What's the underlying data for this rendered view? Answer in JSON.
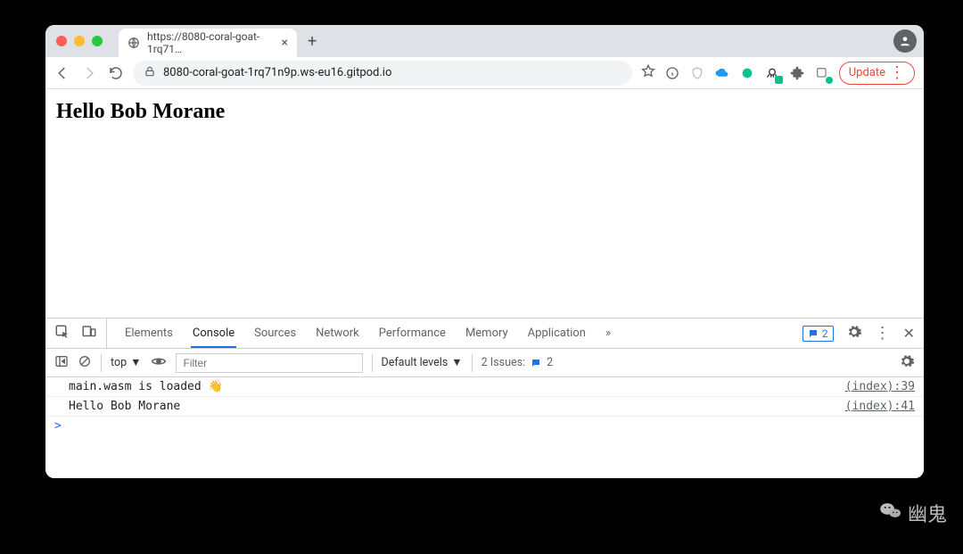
{
  "browser": {
    "tab": {
      "title": "https://8080-coral-goat-1rq71…",
      "favicon": "globe-icon"
    },
    "omnibox": {
      "host": "8080-coral-goat-1rq71n9p.ws-eu16.gitpod.io",
      "scheme_icon": "lock-icon"
    },
    "update_label": "Update"
  },
  "page": {
    "heading": "Hello Bob Morane"
  },
  "devtools": {
    "tabs": {
      "elements": "Elements",
      "console": "Console",
      "sources": "Sources",
      "network": "Network",
      "performance": "Performance",
      "memory": "Memory",
      "application": "Application",
      "more": "»"
    },
    "notice_count": "2",
    "filter_placeholder": "Filter",
    "context_label": "top",
    "levels_label": "Default levels",
    "issues_label": "2 Issues:",
    "issues_count": "2",
    "console": [
      {
        "msg": "main.wasm is loaded 👋",
        "src": "(index):39"
      },
      {
        "msg": "Hello Bob Morane",
        "src": "(index):41"
      }
    ],
    "prompt_glyph": ">"
  },
  "watermark": {
    "text": "幽鬼",
    "icon": "wechat-icon"
  }
}
